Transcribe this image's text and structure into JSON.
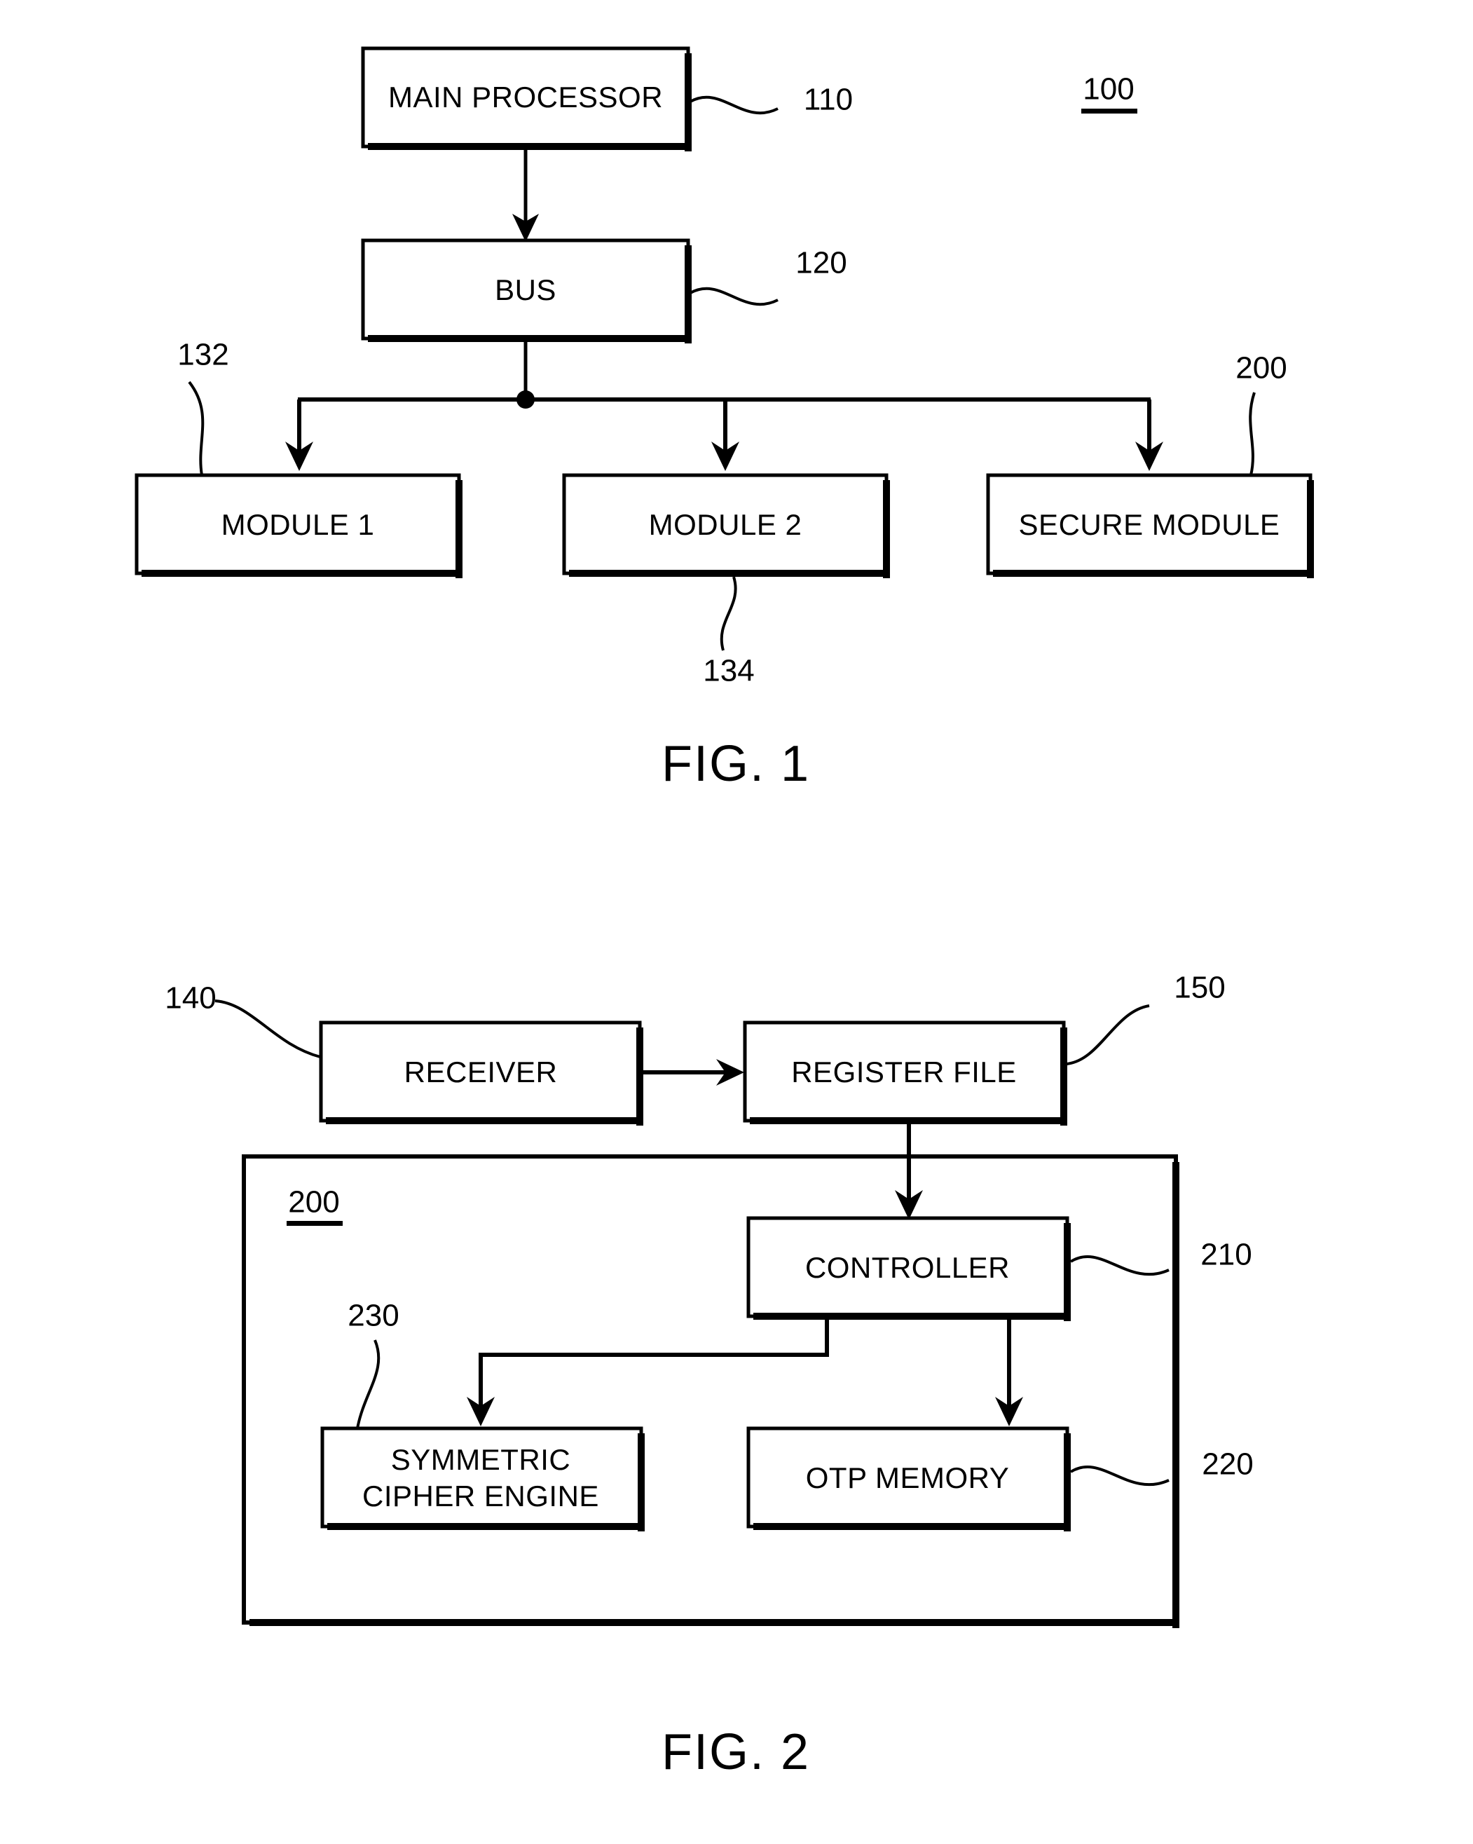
{
  "document": {
    "type": "patent-drawing-sheet",
    "background": "#ffffff",
    "stroke_color": "#000000"
  },
  "figures": [
    {
      "id": "fig1",
      "caption": "FIG. 1",
      "system_ref": "100",
      "blocks": [
        {
          "id": "main-processor",
          "label": "MAIN PROCESSOR",
          "ref": "110"
        },
        {
          "id": "bus",
          "label": "BUS",
          "ref": "120"
        },
        {
          "id": "module-1",
          "label": "MODULE 1",
          "ref": "132"
        },
        {
          "id": "module-2",
          "label": "MODULE 2",
          "ref": "134"
        },
        {
          "id": "secure-module",
          "label": "SECURE MODULE",
          "ref": "200"
        }
      ]
    },
    {
      "id": "fig2",
      "caption": "FIG. 2",
      "container_ref": "200",
      "blocks": [
        {
          "id": "receiver",
          "label": "RECEIVER",
          "ref": "140"
        },
        {
          "id": "register-file",
          "label": "REGISTER FILE",
          "ref": "150"
        },
        {
          "id": "controller",
          "label": "CONTROLLER",
          "ref": "210"
        },
        {
          "id": "symmetric-cipher-engine",
          "label_line1": "SYMMETRIC",
          "label_line2": "CIPHER ENGINE",
          "ref": "230"
        },
        {
          "id": "otp-memory",
          "label": "OTP MEMORY",
          "ref": "220"
        }
      ]
    }
  ],
  "labels": {
    "fig1_caption": "FIG. 1",
    "fig2_caption": "FIG. 2",
    "main_processor": "MAIN PROCESSOR",
    "bus": "BUS",
    "module_1": "MODULE 1",
    "module_2": "MODULE 2",
    "secure_module": "SECURE MODULE",
    "receiver": "RECEIVER",
    "register_file": "REGISTER FILE",
    "controller": "CONTROLLER",
    "cipher_line1": "SYMMETRIC",
    "cipher_line2": "CIPHER ENGINE",
    "otp_memory": "OTP MEMORY"
  },
  "refs": {
    "r100": "100",
    "r110": "110",
    "r120": "120",
    "r132": "132",
    "r134": "134",
    "r200_fig1": "200",
    "r140": "140",
    "r150": "150",
    "r200_fig2": "200",
    "r210": "210",
    "r220": "220",
    "r230": "230"
  }
}
